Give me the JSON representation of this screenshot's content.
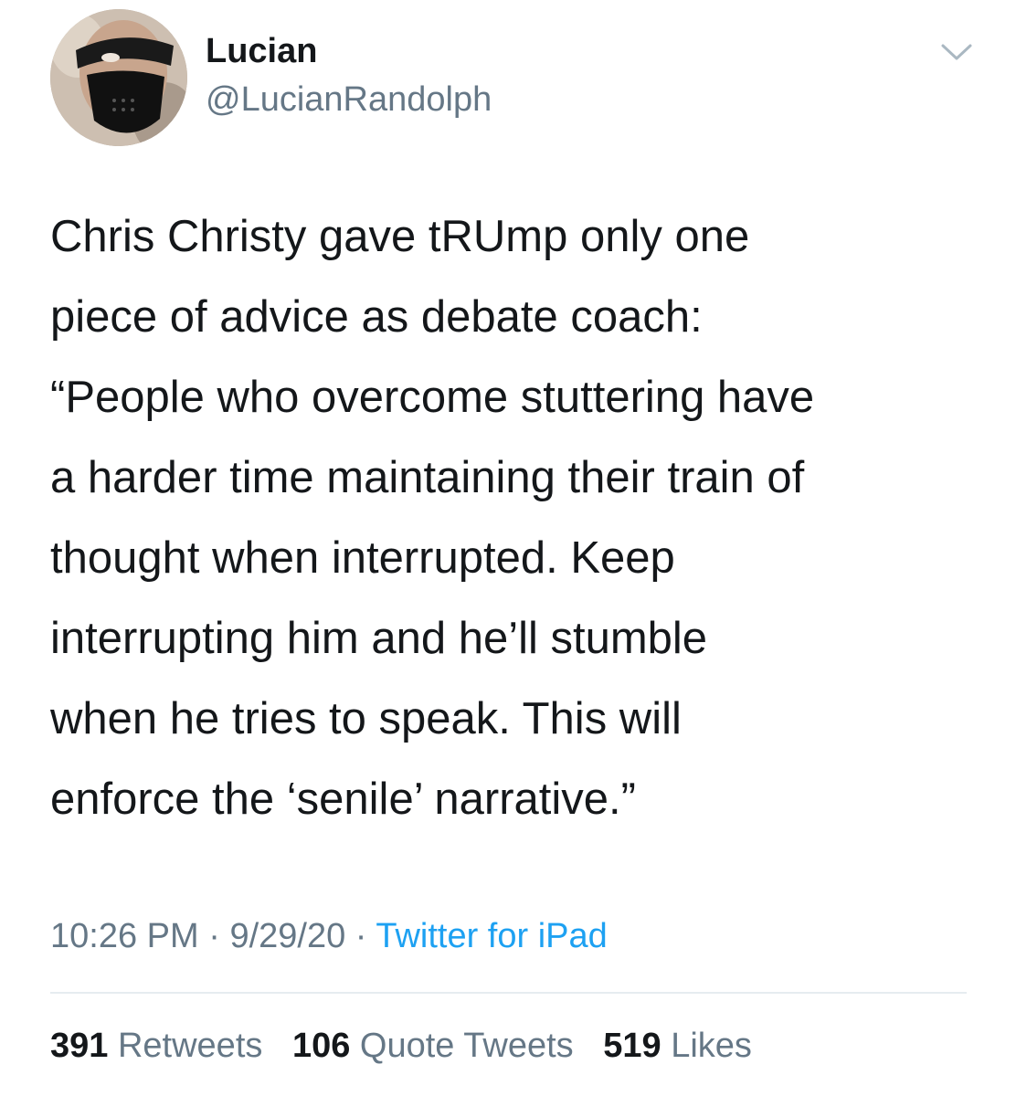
{
  "author": {
    "name": "Lucian",
    "handle": "@LucianRandolph",
    "avatar_icon": "masked-person-avatar"
  },
  "tweet": {
    "paragraphs": [
      "Chris Christy gave tRUmp only one\npiece of advice as debate coach:",
      "“People who overcome stuttering have\na harder time maintaining their train of\nthought when interrupted. Keep\ninterrupting him and he’ll stumble\nwhen he tries to speak. This will\nenforce the ‘senile’ narrative.”"
    ]
  },
  "meta": {
    "time": "10:26 PM",
    "separator": " · ",
    "date": "9/29/20",
    "source": "Twitter for iPad"
  },
  "stats": {
    "retweets_count": "391",
    "retweets_label": "Retweets",
    "quote_tweets_count": "106",
    "quote_tweets_label": "Quote Tweets",
    "likes_count": "519",
    "likes_label": "Likes"
  },
  "colors": {
    "text": "#14171a",
    "secondary": "#657786",
    "link": "#1da1f2",
    "divider": "#e6ecf0"
  }
}
